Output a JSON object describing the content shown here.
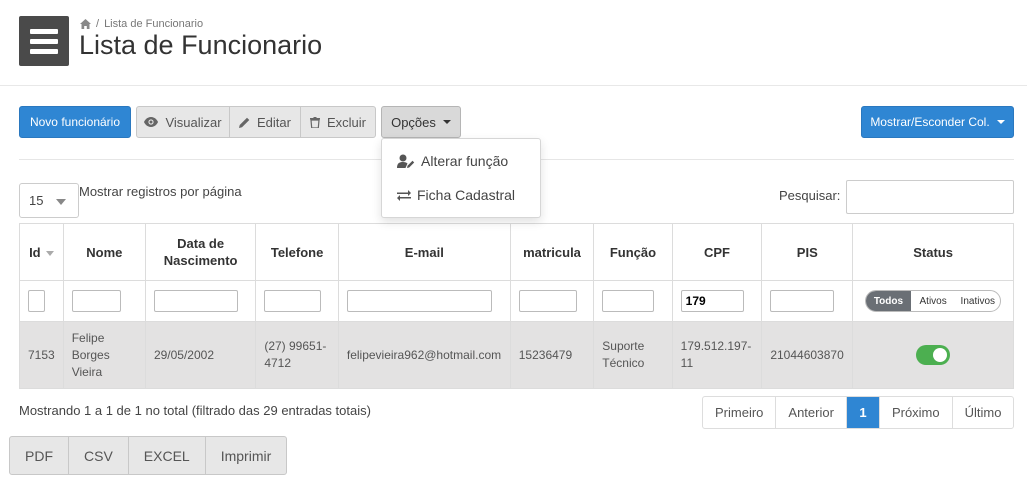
{
  "header": {
    "breadcrumb": "Lista de Funcionario",
    "title": "Lista de Funcionario"
  },
  "toolbar": {
    "new_label": "Novo funcionário",
    "view_label": "Visualizar",
    "edit_label": "Editar",
    "delete_label": "Excluir",
    "options_label": "Opções",
    "columns_label": "Mostrar/Esconder Col."
  },
  "options_menu": {
    "items": [
      {
        "label": "Alterar função",
        "icon": "user-edit-icon"
      },
      {
        "label": "Ficha Cadastral",
        "icon": "exchange-icon"
      }
    ]
  },
  "table_controls": {
    "length_value": "15",
    "length_label": "Mostrar registros por página",
    "search_label": "Pesquisar:",
    "search_value": ""
  },
  "table": {
    "columns": [
      "Id",
      "Nome",
      "Data de Nascimento",
      "Telefone",
      "E-mail",
      "matricula",
      "Função",
      "CPF",
      "PIS",
      "Status"
    ],
    "filters": {
      "id": "",
      "nome": "",
      "data": "",
      "telefone": "",
      "email": "",
      "matricula": "",
      "funcao": "",
      "cpf": "179",
      "pis": ""
    },
    "status_filter": [
      "Todos",
      "Ativos",
      "Inativos"
    ],
    "status_filter_selected": "Todos",
    "rows": [
      {
        "id": "7153",
        "nome": "Felipe Borges Vieira",
        "data": "29/05/2002",
        "telefone": "(27) 99651-4712",
        "email": "felipevieira962@hotmail.com",
        "matricula": "15236479",
        "funcao": "Suporte Técnico",
        "cpf": "179.512.197-11",
        "pis": "21044603870",
        "status_active": true
      }
    ]
  },
  "info": "Mostrando 1 a 1 de 1 no total (filtrado das 29 entradas totais)",
  "pagination": {
    "first": "Primeiro",
    "prev": "Anterior",
    "current": "1",
    "next": "Próximo",
    "last": "Último"
  },
  "export": [
    "PDF",
    "CSV",
    "EXCEL",
    "Imprimir"
  ],
  "colors": {
    "primary": "#2f86d3",
    "toggle_on": "#4caf50",
    "row_bg": "#e3e2e2"
  }
}
